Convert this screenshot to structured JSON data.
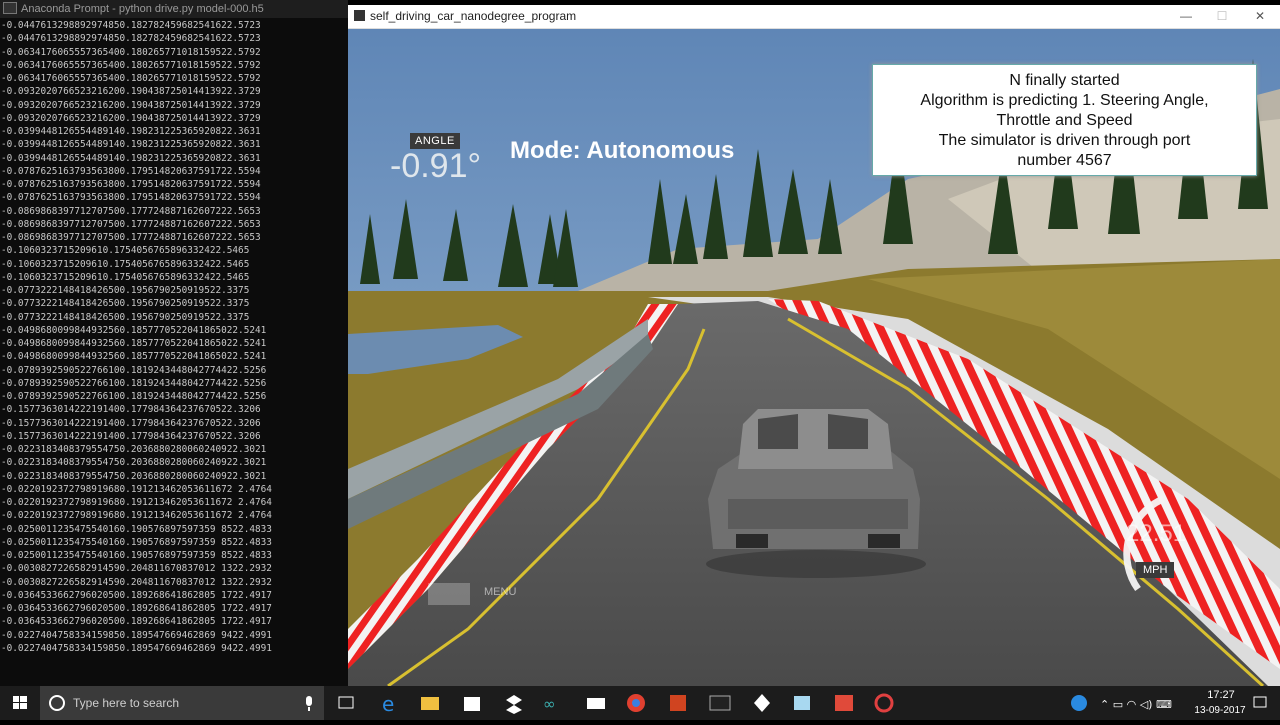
{
  "console": {
    "title": "Anaconda Prompt - python  drive.py model-000.h5",
    "lines": [
      "-0.0447613298892974850.182782459682541622.5723",
      "-0.0447613298892974850.182782459682541622.5723",
      "-0.0634176065557365400.180265771018159522.5792",
      "-0.0634176065557365400.180265771018159522.5792",
      "-0.0634176065557365400.180265771018159522.5792",
      "-0.0932020766523216200.190438725014413922.3729",
      "-0.0932020766523216200.190438725014413922.3729",
      "-0.0932020766523216200.190438725014413922.3729",
      "-0.0399448126554489140.198231225365920822.3631",
      "-0.0399448126554489140.198231225365920822.3631",
      "-0.0399448126554489140.198231225365920822.3631",
      "-0.0787625163793563800.179514820637591722.5594",
      "-0.0787625163793563800.179514820637591722.5594",
      "-0.0787625163793563800.179514820637591722.5594",
      "-0.0869868397712707500.177724887162607222.5653",
      "-0.0869868397712707500.177724887162607222.5653",
      "-0.0869868397712707500.177724887162607222.5653",
      "-0.1060323715209610.1754056765896332422.5465",
      "-0.1060323715209610.1754056765896332422.5465",
      "-0.1060323715209610.1754056765896332422.5465",
      "-0.0773222148418426500.1956790250919522.3375",
      "-0.0773222148418426500.1956790250919522.3375",
      "-0.0773222148418426500.1956790250919522.3375",
      "-0.0498680099844932560.1857770522041865022.5241",
      "-0.0498680099844932560.1857770522041865022.5241",
      "-0.0498680099844932560.1857770522041865022.5241",
      "-0.0789392590522766100.1819243448042774422.5256",
      "-0.0789392590522766100.1819243448042774422.5256",
      "-0.0789392590522766100.1819243448042774422.5256",
      "-0.1577363014222191400.177984364237670522.3206",
      "-0.1577363014222191400.177984364237670522.3206",
      "-0.1577363014222191400.177984364237670522.3206",
      "-0.0223183408379554750.2036880280060240922.3021",
      "-0.0223183408379554750.2036880280060240922.3021",
      "-0.0223183408379554750.2036880280060240922.3021",
      "-0.0220192372798919680.191213462053611672 2.4764",
      "-0.0220192372798919680.191213462053611672 2.4764",
      "-0.0220192372798919680.191213462053611672 2.4764",
      "-0.0250011235475540160.190576897597359 8522.4833",
      "-0.0250011235475540160.190576897597359 8522.4833",
      "-0.0250011235475540160.190576897597359 8522.4833",
      "-0.0030827226582914590.204811670837012 1322.2932",
      "-0.0030827226582914590.204811670837012 1322.2932",
      "-0.0364533662796020500.189268641862805 1722.4917",
      "-0.0364533662796020500.189268641862805 1722.4917",
      "-0.0364533662796020500.189268641862805 1722.4917",
      "-0.0227404758334159850.189547669462869 9422.4991",
      "-0.0227404758334159850.189547669462869 9422.4991"
    ]
  },
  "simulator": {
    "title": "self_driving_car_nanodegree_program",
    "angle_label": "ANGLE",
    "angle_value": "-0.91°",
    "mode_text": "Mode: Autonomous",
    "overlay_lines": [
      "N finally started",
      "Algorithm is predicting 1. Steering Angle,",
      "Throttle and Speed",
      "The simulator is driven through port",
      "number 4567"
    ],
    "menu_label": "MENU",
    "speed_value": "22.51",
    "speed_unit": "MPH",
    "win_min": "—",
    "win_max": "☐",
    "win_close": "✕"
  },
  "taskbar": {
    "search_placeholder": "Type here to search",
    "time": "17:27",
    "date": "13-09-2017",
    "apps": [
      "task-view",
      "edge",
      "file-explorer",
      "store",
      "dropbox",
      "arduino",
      "mail",
      "chrome",
      "powerpoint",
      "terminal",
      "unity",
      "app-blue",
      "app-red",
      "unity-gear"
    ]
  },
  "colors": {
    "sky": "#6f95c2",
    "grass": "#8a7a30",
    "road": "#5a5a5a",
    "curb_red": "#e02020"
  }
}
